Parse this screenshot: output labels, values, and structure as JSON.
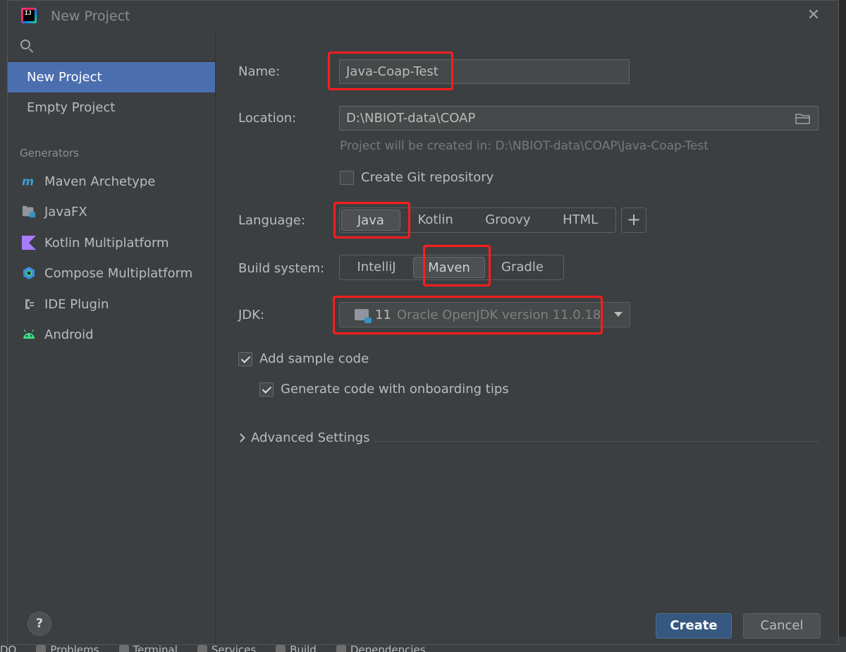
{
  "dialog": {
    "title": "New Project",
    "app_icon_text": "IJ",
    "close_icon": "close-icon"
  },
  "sidebar": {
    "search_placeholder": "",
    "items": [
      {
        "label": "New Project",
        "selected": true
      },
      {
        "label": "Empty Project",
        "selected": false
      }
    ],
    "generators_heading": "Generators",
    "generators": [
      {
        "label": "Maven Archetype",
        "icon": "maven-icon"
      },
      {
        "label": "JavaFX",
        "icon": "javafx-folder-icon"
      },
      {
        "label": "Kotlin Multiplatform",
        "icon": "kotlin-icon"
      },
      {
        "label": "Compose Multiplatform",
        "icon": "compose-icon"
      },
      {
        "label": "IDE Plugin",
        "icon": "plugin-icon"
      },
      {
        "label": "Android",
        "icon": "android-icon"
      }
    ],
    "help_label": "?"
  },
  "form": {
    "name_label": "Name:",
    "name_value": "Java-Coap-Test",
    "location_label": "Location:",
    "location_value": "D:\\NBIOT-data\\COAP",
    "location_hint": "Project will be created in: D:\\NBIOT-data\\COAP\\Java-Coap-Test",
    "git_label": "Create Git repository",
    "git_checked": false,
    "language_label": "Language:",
    "languages": [
      "Java",
      "Kotlin",
      "Groovy",
      "HTML"
    ],
    "language_selected": "Java",
    "language_add": "+",
    "build_label": "Build system:",
    "build_systems": [
      "IntelliJ",
      "Maven",
      "Gradle"
    ],
    "build_selected": "Maven",
    "jdk_label": "JDK:",
    "jdk_version": "11",
    "jdk_name": "Oracle OpenJDK version 11.0.18",
    "sample_label": "Add sample code",
    "sample_checked": true,
    "onboarding_label": "Generate code with onboarding tips",
    "onboarding_checked": true,
    "advanced_label": "Advanced Settings"
  },
  "buttons": {
    "create": "Create",
    "cancel": "Cancel"
  },
  "background": {
    "bottom_tabs": [
      "DO",
      "Problems",
      "Terminal",
      "Services",
      "Build",
      "Dependencies"
    ]
  },
  "colors": {
    "accent": "#4b6eaf",
    "primary_button": "#365880",
    "highlight": "#ff1d1d"
  }
}
